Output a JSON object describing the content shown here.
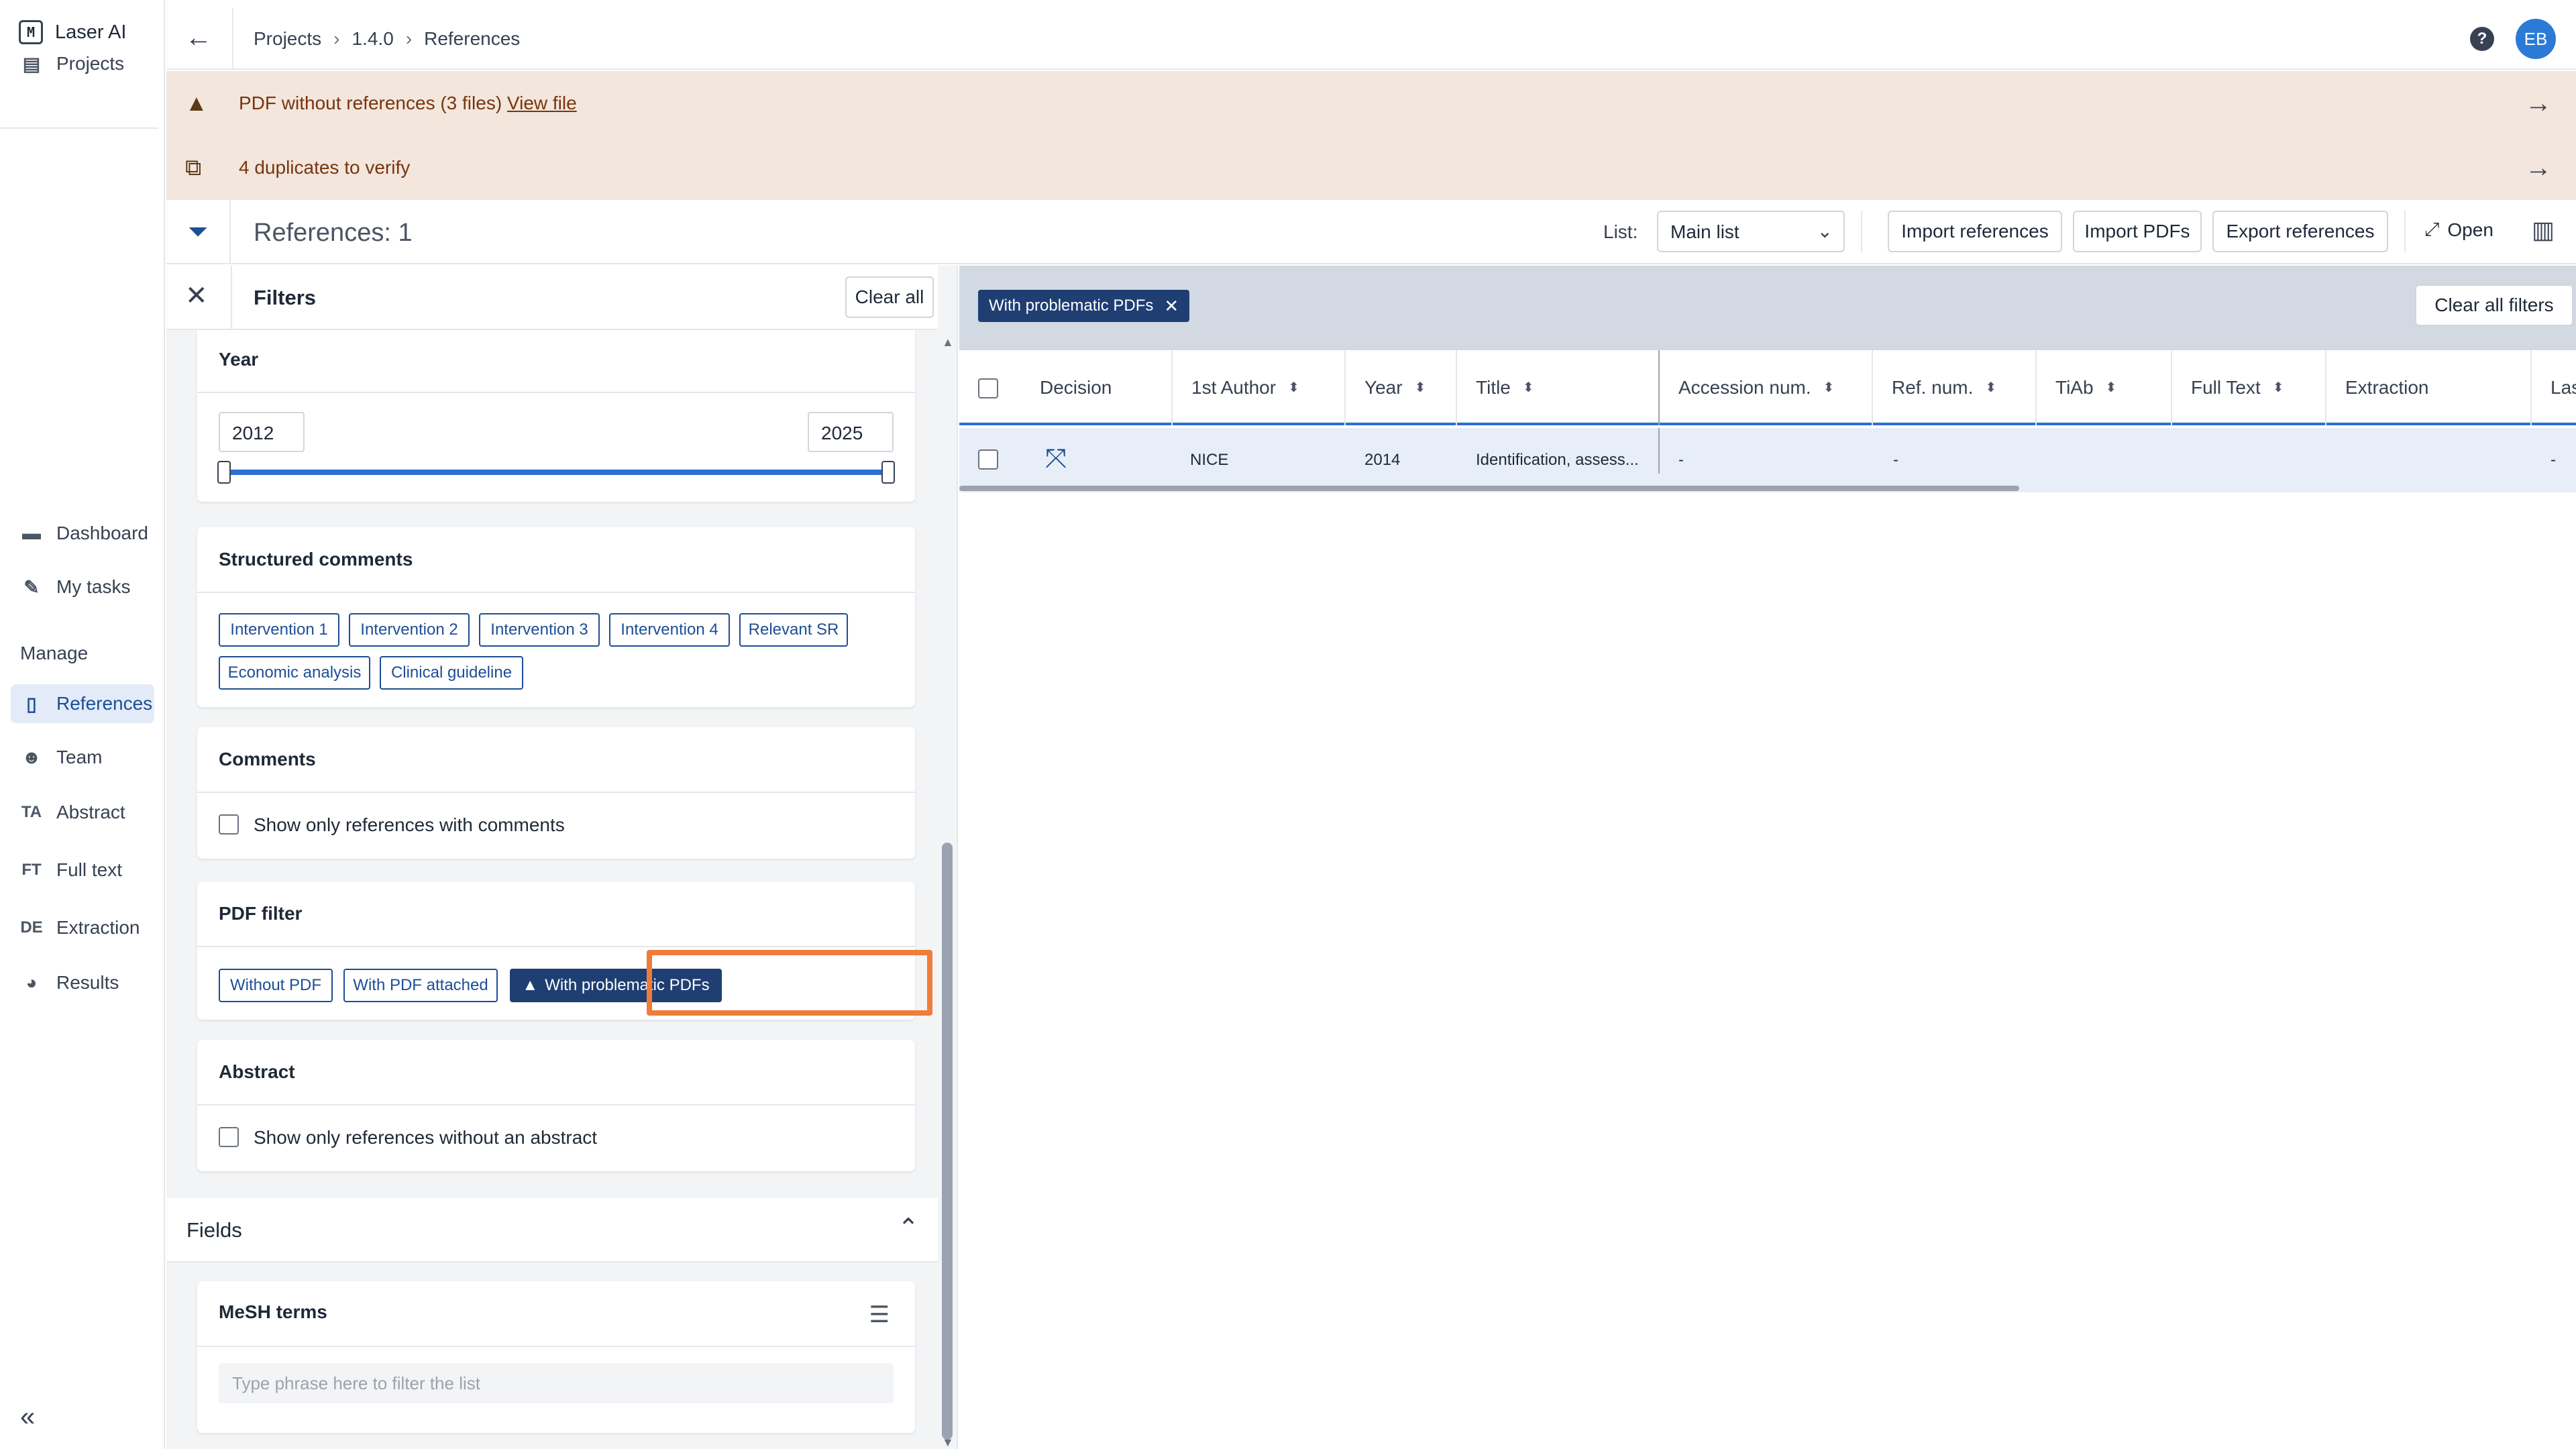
{
  "app": {
    "name": "Laser AI",
    "logo_icon": "laser-ai-logo"
  },
  "nav": {
    "projects": "Projects",
    "dashboard": "Dashboard",
    "my_tasks": "My tasks",
    "manage_heading": "Manage",
    "references": "References",
    "team": "Team",
    "abstract_abbr": "TA",
    "abstract": "Abstract",
    "fulltext_abbr": "FT",
    "fulltext": "Full text",
    "extraction_abbr": "DE",
    "extraction": "Extraction",
    "results": "Results",
    "collapse": "«"
  },
  "topbar": {
    "breadcrumb": [
      "Projects",
      "1.4.0",
      "References"
    ],
    "help": "?",
    "avatar_initials": "EB"
  },
  "alerts": {
    "pdf_text": "PDF without references (3 files)",
    "pdf_link": "View file",
    "duplicates_text": "4 duplicates to verify"
  },
  "toolbar": {
    "references_count": "References: 1",
    "list_label": "List:",
    "list_value": "Main list",
    "import_references": "Import references",
    "import_pdfs": "Import PDFs",
    "export_references": "Export references",
    "open": "Open"
  },
  "filters": {
    "title": "Filters",
    "clear_all": "Clear all",
    "year": {
      "title": "Year",
      "min": "2012",
      "max": "2025"
    },
    "structured_comments": {
      "title": "Structured comments",
      "tags": [
        "Intervention 1",
        "Intervention 2",
        "Intervention 3",
        "Intervention 4",
        "Relevant SR",
        "Economic analysis",
        "Clinical guideline"
      ]
    },
    "comments": {
      "title": "Comments",
      "checkbox_label": "Show only references with comments"
    },
    "pdf_filter": {
      "title": "PDF filter",
      "options": [
        "Without PDF",
        "With PDF attached",
        "With problematic PDFs"
      ],
      "selected": "With problematic PDFs"
    },
    "abstract": {
      "title": "Abstract",
      "checkbox_label": "Show only references without an abstract"
    },
    "fields": {
      "title": "Fields",
      "mesh_title": "MeSH terms",
      "mesh_placeholder": "Type phrase here to filter the list"
    }
  },
  "results": {
    "active_chip": "With problematic PDFs",
    "clear_all_filters": "Clear all filters",
    "columns": [
      "Decision",
      "1st Author",
      "Year",
      "Title",
      "Accession num.",
      "Ref. num.",
      "TiAb",
      "Full Text",
      "Extraction",
      "Las"
    ],
    "rows": [
      {
        "author": "NICE",
        "year": "2014",
        "title": "Identification, assess...",
        "accession": "-",
        "ref_num": "-",
        "last": "-"
      }
    ]
  },
  "colors": {
    "accent": "#1d4e96",
    "selected_tag": "#1f3f73",
    "alert_bg": "#f3e6dc",
    "highlight": "#f07c3a",
    "chip_bar": "#d2d9e2"
  }
}
